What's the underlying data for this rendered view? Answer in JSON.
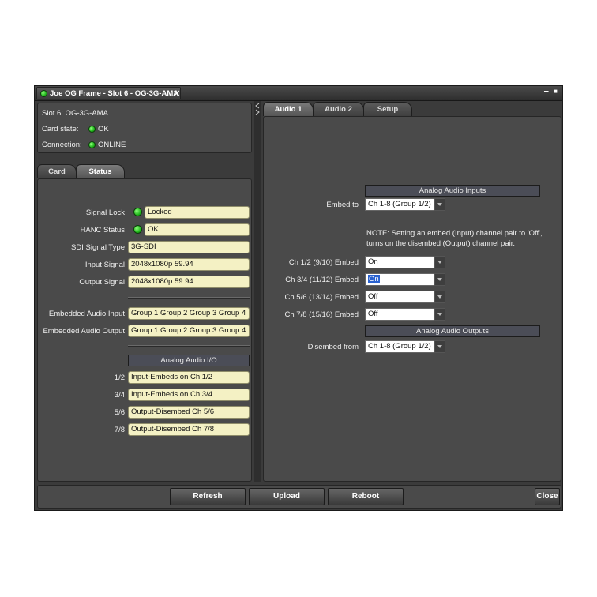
{
  "window": {
    "title": "Joe OG Frame - Slot 6 - OG-3G-AMA",
    "close_glyph": "✕",
    "minimize_glyph": "‒",
    "maximize_glyph": "■"
  },
  "card_info": {
    "slot": "Slot 6: OG-3G-AMA",
    "card_state_label": "Card state:",
    "card_state_value": "OK",
    "connection_label": "Connection:",
    "connection_value": "ONLINE"
  },
  "left_tabs": [
    {
      "label": "Card",
      "active": false
    },
    {
      "label": "Status",
      "active": true
    }
  ],
  "status": {
    "signal_lock_label": "Signal Lock",
    "signal_lock_value": "Locked",
    "hanc_status_label": "HANC Status",
    "hanc_status_value": "OK",
    "sdi_type_label": "SDI Signal Type",
    "sdi_type_value": "3G-SDI",
    "input_signal_label": "Input Signal",
    "input_signal_value": "2048x1080p 59.94",
    "output_signal_label": "Output Signal",
    "output_signal_value": "2048x1080p 59.94",
    "emb_in_label": "Embedded Audio Input",
    "emb_in_value": "Group 1 Group 2 Group 3 Group 4",
    "emb_out_label": "Embedded Audio Output",
    "emb_out_value": "Group 1 Group 2 Group 3 Group 4",
    "analog_io_header": "Analog Audio I/O",
    "io_rows": [
      {
        "label": "1/2",
        "value": "Input-Embeds on Ch 1/2"
      },
      {
        "label": "3/4",
        "value": "Input-Embeds on Ch 3/4"
      },
      {
        "label": "5/6",
        "value": "Output-Disembed Ch 5/6"
      },
      {
        "label": "7/8",
        "value": "Output-Disembed Ch 7/8"
      }
    ]
  },
  "right_tabs": [
    {
      "label": "Audio 1",
      "active": true
    },
    {
      "label": "Audio 2",
      "active": false
    },
    {
      "label": "Setup",
      "active": false
    }
  ],
  "audio1": {
    "inputs_header": "Analog Audio Inputs",
    "embed_to_label": "Embed to",
    "embed_to_value": "Ch 1-8  (Group 1/2)",
    "note_line1": "NOTE: Setting an embed (Input) channel pair to 'Off',",
    "note_line2": "turns on the disembed (Output) channel pair.",
    "embeds": [
      {
        "label": "Ch 1/2 (9/10) Embed",
        "value": "On",
        "highlighted": false
      },
      {
        "label": "Ch 3/4 (11/12) Embed",
        "value": "On",
        "highlighted": true
      },
      {
        "label": "Ch 5/6 (13/14) Embed",
        "value": "Off",
        "highlighted": false
      },
      {
        "label": "Ch 7/8 (15/16) Embed",
        "value": "Off",
        "highlighted": false
      }
    ],
    "outputs_header": "Analog Audio Outputs",
    "disembed_label": "Disembed from",
    "disembed_value": "Ch 1-8  (Group 1/2)"
  },
  "buttons": {
    "refresh": "Refresh",
    "upload": "Upload",
    "reboot": "Reboot",
    "close": "Close"
  },
  "colors": {
    "led_green": "#1fb51a",
    "field_bg": "#f4f1c4",
    "header_bg": "#4b4d57",
    "panel_bg": "#3b3b3b"
  }
}
